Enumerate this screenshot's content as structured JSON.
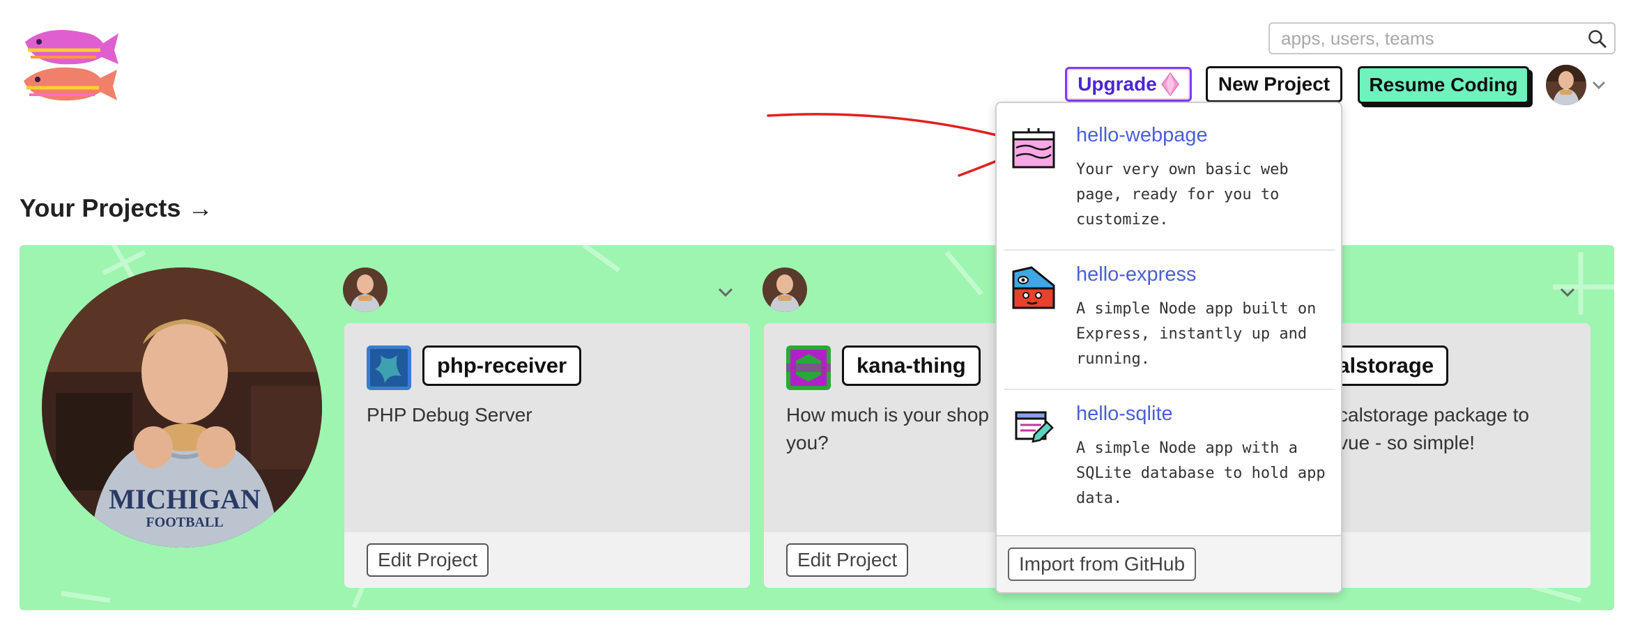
{
  "header": {
    "logo_icon": "glitch-fish-logo-icon",
    "search": {
      "placeholder": "apps, users, teams",
      "icon": "search-icon"
    },
    "upgrade_label": "Upgrade",
    "upgrade_icon": "diamond-icon",
    "new_project_label": "New Project",
    "resume_label": "Resume Coding",
    "user_menu_icon": "chevron-down-icon"
  },
  "projects": {
    "section_title": "Your Projects →",
    "cards": [
      {
        "name": "php-receiver",
        "description": "PHP Debug Server",
        "edit_label": "Edit Project",
        "icon": "project-avatar-icon"
      },
      {
        "name": "kana-thing",
        "description": "How much is your shop",
        "description_line2": "you?",
        "edit_label": "Edit Project",
        "icon": "project-avatar-icon"
      },
      {
        "name": "calstorage",
        "description": "calstorage package to",
        "description_line2": "vue - so simple!"
      }
    ]
  },
  "new_project_menu": {
    "items": [
      {
        "title": "hello-webpage",
        "description": "Your very own basic web page, ready for you to customize.",
        "icon": "webpage-icon"
      },
      {
        "title": "hello-express",
        "description": "A simple Node app built on Express, instantly up and running.",
        "icon": "express-icon"
      },
      {
        "title": "hello-sqlite",
        "description": "A simple Node app with a SQLite database to hold app data.",
        "icon": "sqlite-icon"
      }
    ],
    "import_label": "Import from GitHub"
  },
  "colors": {
    "band": "#9df5b0",
    "resume_button": "#6ff2bd",
    "upgrade_border": "#7a3ff0",
    "link_blue": "#4b5fd6",
    "annotation_arrow": "#e02020"
  }
}
